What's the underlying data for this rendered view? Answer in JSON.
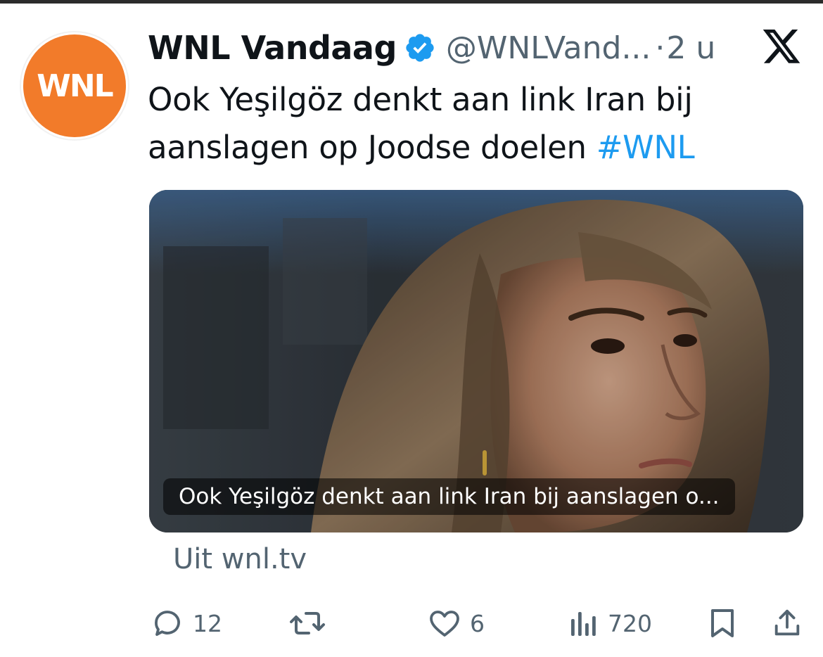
{
  "tweet": {
    "display_name": "WNL Vandaag",
    "handle": "@WNLVand...",
    "separator": "·",
    "time": "2 u",
    "text": "Ook Yeşilgöz denkt aan link Iran bij aanslagen op Joodse doelen",
    "hashtag": "#WNL",
    "avatar_text": "WNL",
    "avatar_color": "#f27b2a",
    "verified_color": "#1d9bf0"
  },
  "card": {
    "caption": "Ook Yeşilgöz denkt aan link Iran bij aanslagen o...",
    "source": "Uit wnl.tv"
  },
  "actions": {
    "replies": "12",
    "reposts": "",
    "likes": "6",
    "views": "720"
  },
  "icons": {
    "avatar": "wnl-logo",
    "verified": "verified-badge-icon",
    "platform": "x-logo-icon",
    "reply": "reply-icon",
    "repost": "repost-icon",
    "like": "heart-icon",
    "views": "views-chart-icon",
    "bookmark": "bookmark-icon",
    "share": "share-icon"
  }
}
